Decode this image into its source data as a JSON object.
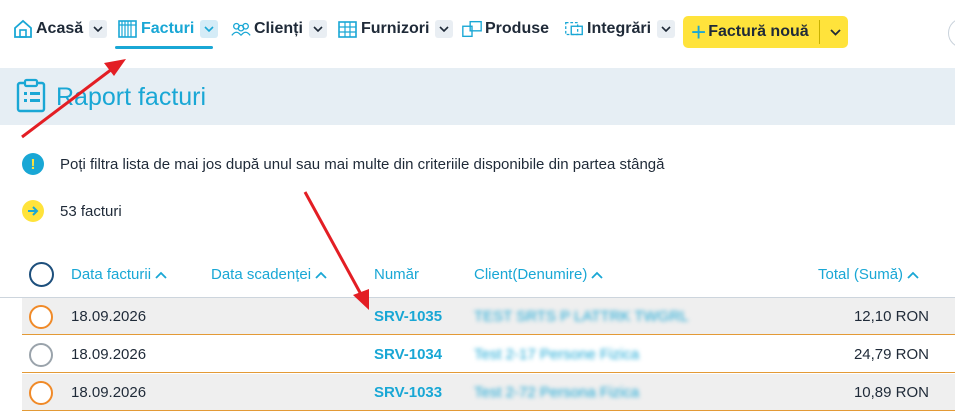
{
  "nav": {
    "items": [
      {
        "label": "Acasă",
        "icon": "home-icon"
      },
      {
        "label": "Facturi",
        "icon": "invoices-icon",
        "active": true
      },
      {
        "label": "Clienți",
        "icon": "clients-icon"
      },
      {
        "label": "Furnizori",
        "icon": "suppliers-icon"
      },
      {
        "label": "Produse",
        "icon": "products-icon"
      },
      {
        "label": "Integrări",
        "icon": "integrations-icon"
      }
    ],
    "new_invoice_label": "Factură nouă"
  },
  "page": {
    "title": "Raport facturi"
  },
  "info": {
    "hint": "Poți filtra lista de mai jos după unul sau mai multe din criteriile disponibile din partea stângă",
    "count": "53 facturi"
  },
  "table": {
    "columns": {
      "date": "Data facturii",
      "due": "Data scadenței",
      "number": "Număr",
      "client": "Client(Denumire)",
      "total": "Total (Sumă)"
    },
    "rows": [
      {
        "date": "18.09.2026",
        "number": "SRV-1035",
        "client": "TEST SRTS P LATTRK TWGRL",
        "total": "12,10 RON"
      },
      {
        "date": "18.09.2026",
        "number": "SRV-1034",
        "client": "Test 2-17 Persone Fizica",
        "total": "24,79 RON"
      },
      {
        "date": "18.09.2026",
        "number": "SRV-1033",
        "client": "Test 2-72 Persona Fizica",
        "total": "10,89 RON"
      }
    ]
  },
  "colors": {
    "accent": "#19a7d5",
    "brand_yellow": "#ffe33b",
    "row_border": "#e39a36",
    "annotation_red": "#e31e24"
  }
}
